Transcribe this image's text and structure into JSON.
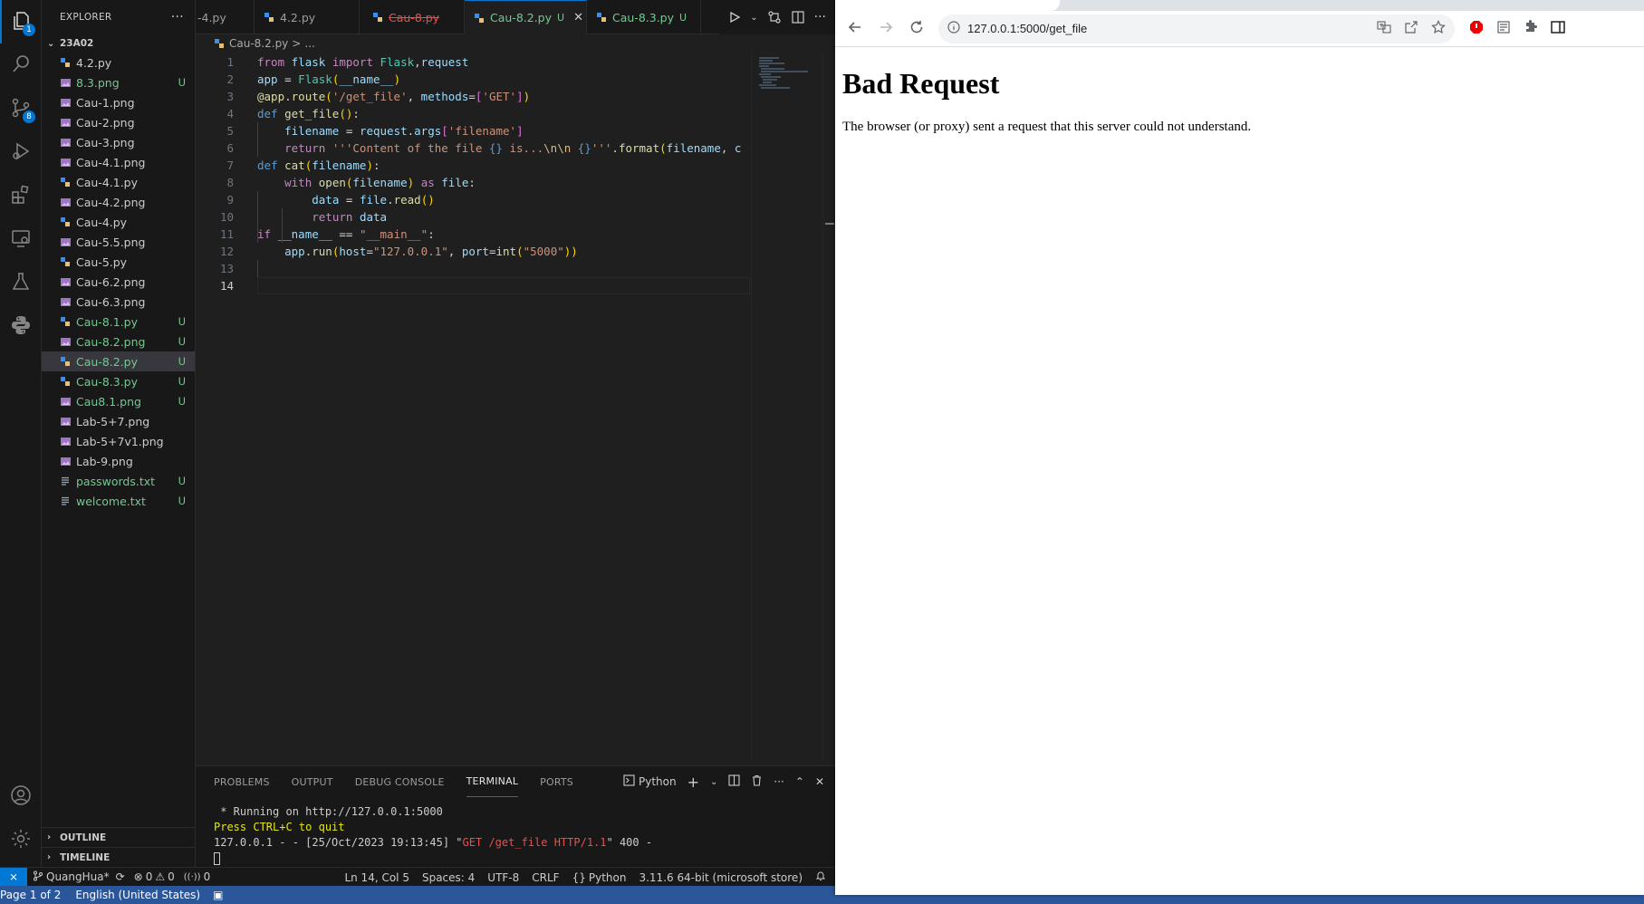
{
  "vscode": {
    "activity_bar": {
      "explorer_badge": "1",
      "scm_badge": "8"
    },
    "explorer": {
      "title": "EXPLORER",
      "more": "···",
      "folder": "23A02",
      "files": [
        {
          "name": "4.2.py",
          "type": "py",
          "status": ""
        },
        {
          "name": "8.3.png",
          "type": "png",
          "status": "U"
        },
        {
          "name": "Cau-1.png",
          "type": "png",
          "status": ""
        },
        {
          "name": "Cau-2.png",
          "type": "png",
          "status": ""
        },
        {
          "name": "Cau-3.png",
          "type": "png",
          "status": ""
        },
        {
          "name": "Cau-4.1.png",
          "type": "png",
          "status": ""
        },
        {
          "name": "Cau-4.1.py",
          "type": "py",
          "status": ""
        },
        {
          "name": "Cau-4.2.png",
          "type": "png",
          "status": ""
        },
        {
          "name": "Cau-4.py",
          "type": "py",
          "status": ""
        },
        {
          "name": "Cau-5.5.png",
          "type": "png",
          "status": ""
        },
        {
          "name": "Cau-5.py",
          "type": "py",
          "status": ""
        },
        {
          "name": "Cau-6.2.png",
          "type": "png",
          "status": ""
        },
        {
          "name": "Cau-6.3.png",
          "type": "png",
          "status": ""
        },
        {
          "name": "Cau-8.1.py",
          "type": "py",
          "status": "U"
        },
        {
          "name": "Cau-8.2.png",
          "type": "png",
          "status": "U"
        },
        {
          "name": "Cau-8.2.py",
          "type": "py",
          "status": "U"
        },
        {
          "name": "Cau-8.3.py",
          "type": "py",
          "status": "U"
        },
        {
          "name": "Cau8.1.png",
          "type": "png",
          "status": "U"
        },
        {
          "name": "Lab-5+7.png",
          "type": "png",
          "status": ""
        },
        {
          "name": "Lab-5+7v1.png",
          "type": "png",
          "status": ""
        },
        {
          "name": "Lab-9.png",
          "type": "png",
          "status": ""
        },
        {
          "name": "passwords.txt",
          "type": "txt",
          "status": "U"
        },
        {
          "name": "welcome.txt",
          "type": "txt",
          "status": "U"
        }
      ],
      "outline": "OUTLINE",
      "timeline": "TIMELINE"
    },
    "tabs": [
      {
        "label": "-4.py",
        "state": "normal"
      },
      {
        "label": "4.2.py",
        "state": "normal"
      },
      {
        "label": "Cau-8.py",
        "state": "deleted"
      },
      {
        "label": "Cau-8.2.py",
        "state": "active",
        "status": "U"
      },
      {
        "label": "Cau-8.3.py",
        "state": "normal",
        "status": "U"
      }
    ],
    "breadcrumb": {
      "file": "Cau-8.2.py",
      "sep": ">",
      "tail": "..."
    },
    "code_lines": [
      "from flask import Flask,request",
      "app = Flask(__name__)",
      "@app.route('/get_file', methods=['GET'])",
      "def get_file():",
      "    filename = request.args['filename']",
      "    return '''Content of the file {} is...\\n\\n {}'''.format(filename, c",
      "def cat(filename):",
      "    with open(filename) as file:",
      "        data = file.read()",
      "        return data",
      "if __name__ == \"__main__\":",
      "    app.run(host=\"127.0.0.1\", port=int(\"5000\"))",
      "",
      ""
    ],
    "panel": {
      "tabs": [
        "PROBLEMS",
        "OUTPUT",
        "DEBUG CONSOLE",
        "TERMINAL",
        "PORTS"
      ],
      "active_tab": "TERMINAL",
      "terminal_name": "Python",
      "terminal": {
        "line1": " * Running on http://127.0.0.1:5000",
        "line2": "Press CTRL+C to quit",
        "line3_prefix": "127.0.0.1 - - [25/Oct/2023 19:13:45] \"",
        "line3_request": "GET /get_file HTTP/1.1",
        "line3_suffix": "\" 400 -"
      }
    },
    "status_bar": {
      "branch": "QuangHua*",
      "errors": "0",
      "warnings": "0",
      "ports": "0",
      "position": "Ln 14, Col 5",
      "spaces": "Spaces: 4",
      "encoding": "UTF-8",
      "eol": "CRLF",
      "language": "Python",
      "interpreter": "3.11.6 64-bit (microsoft store)"
    }
  },
  "word_status": {
    "page": "Page 1 of 2",
    "language": "English (United States)"
  },
  "browser": {
    "url": "127.0.0.1:5000/get_file",
    "page_heading": "Bad Request",
    "page_text": "The browser (or proxy) sent a request that this server could not understand."
  },
  "colors": {
    "accent": "#0078d4",
    "untracked": "#73c991",
    "deleted": "#f14c4c"
  }
}
